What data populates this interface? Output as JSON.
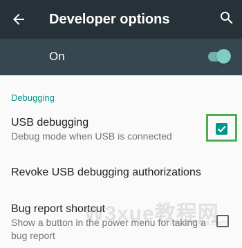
{
  "appbar": {
    "title": "Developer options",
    "back_icon": "arrow-left-icon",
    "search_icon": "search-icon",
    "background_color": "#263238"
  },
  "master_switch": {
    "label": "On",
    "state": true,
    "accent_color": "#80cbc4"
  },
  "sections": [
    {
      "header": "Debugging",
      "items": [
        {
          "title": "USB debugging",
          "summary": "Debug mode when USB is connected",
          "checked": true
        },
        {
          "title": "Revoke USB debugging authorizations"
        },
        {
          "title": "Bug report shortcut",
          "summary": "Show a button in the power menu for taking a bug report",
          "checked": false
        }
      ]
    }
  ],
  "watermark": {
    "text": "W3xue教程网",
    "subtext": "www.w3xue.com"
  },
  "colors": {
    "accent": "#009688",
    "highlight": "#4caf50"
  }
}
